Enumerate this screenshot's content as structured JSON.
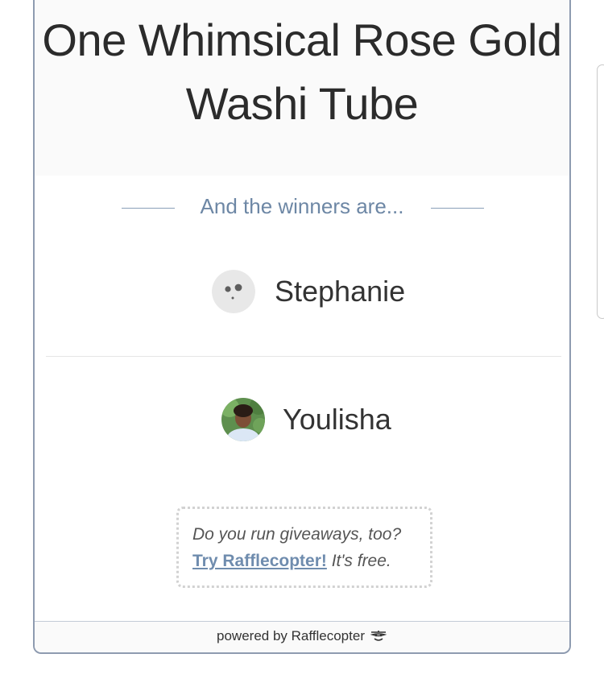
{
  "prize": {
    "title": "One Whimsical Rose Gold Washi Tube"
  },
  "winners_heading": "And the winners are...",
  "winners": [
    {
      "name": "Stephanie",
      "avatar_icon": "default-face-avatar-icon"
    },
    {
      "name": "Youlisha",
      "avatar_icon": "profile-photo-avatar"
    }
  ],
  "promo": {
    "question": "Do you run giveaways, too?",
    "link_label": "Try Rafflecopter!",
    "free_text": "It's free."
  },
  "footer": {
    "text": "powered by Rafflecopter",
    "icon": "rafflecopter-face-icon"
  },
  "colors": {
    "accent": "#6f8cae",
    "heading": "#6d87a5",
    "border": "#8e9bb0",
    "text": "#333333"
  }
}
